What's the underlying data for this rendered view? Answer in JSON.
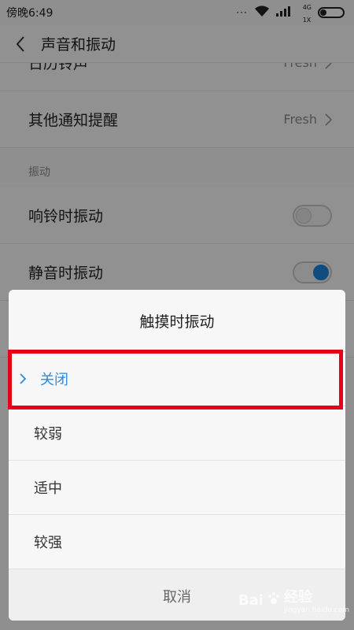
{
  "status_bar": {
    "time": "傍晚6:49",
    "dots": "···",
    "network_label": "4G",
    "network_sub": "1X"
  },
  "header": {
    "title": "声音和振动"
  },
  "settings": {
    "partial_row_label": "日历铃声",
    "partial_row_value": "Fresh",
    "other_notify_label": "其他通知提醒",
    "other_notify_value": "Fresh",
    "vibration_section": "振动",
    "ring_vibrate_label": "响铃时振动",
    "ring_vibrate_on": false,
    "silent_vibrate_label": "静音时振动",
    "silent_vibrate_on": true
  },
  "dialog": {
    "title": "触摸时振动",
    "options": [
      {
        "label": "关闭",
        "selected": true
      },
      {
        "label": "较弱",
        "selected": false
      },
      {
        "label": "适中",
        "selected": false
      },
      {
        "label": "较强",
        "selected": false
      }
    ],
    "cancel_label": "取消"
  },
  "watermark": {
    "brand": "Bai",
    "brand2": "经验",
    "url": "jingyan.baidu.com"
  },
  "colors": {
    "accent": "#2a8be0",
    "highlight": "#e6001a",
    "toggle_on": "#1a86de"
  }
}
